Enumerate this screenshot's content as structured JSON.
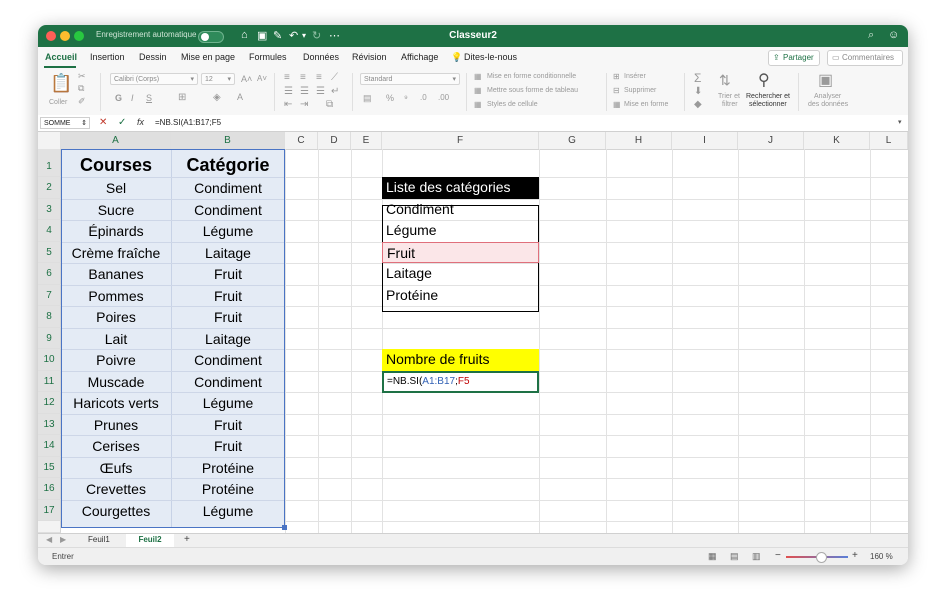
{
  "titlebar": {
    "autosave_label": "Enregistrement automatique",
    "document_title": "Classeur2"
  },
  "menu": {
    "tabs": [
      "Accueil",
      "Insertion",
      "Dessin",
      "Mise en page",
      "Formules",
      "Données",
      "Révision",
      "Affichage"
    ],
    "tell_me": "Dites-le-nous",
    "share": "Partager",
    "comments": "Commentaires"
  },
  "ribbon": {
    "paste": "Coller",
    "font_name": "Calibri (Corps)",
    "font_size": "12",
    "number_format": "Standard",
    "conditional_format": "Mise en forme conditionnelle",
    "format_as_table": "Mettre sous forme de tableau",
    "cell_styles": "Styles de cellule",
    "insert": "Insérer",
    "delete": "Supprimer",
    "format": "Mise en forme",
    "sort_filter_1": "Trier et",
    "sort_filter_2": "filtrer",
    "find_select_1": "Rechercher et",
    "find_select_2": "sélectionner",
    "analyze_1": "Analyser",
    "analyze_2": "des données"
  },
  "formula_bar": {
    "name_box": "SOMME",
    "fx": "fx",
    "content": "=NB.SI(A1:B17;F5"
  },
  "columns": [
    "A",
    "B",
    "C",
    "D",
    "E",
    "F",
    "G",
    "H",
    "I",
    "J",
    "K",
    "L"
  ],
  "rows": [
    "1",
    "2",
    "3",
    "4",
    "5",
    "6",
    "7",
    "8",
    "9",
    "10",
    "11",
    "12",
    "13",
    "14",
    "15",
    "16",
    "17"
  ],
  "table": {
    "header_a": "Courses",
    "header_b": "Catégorie",
    "items": [
      {
        "course": "Sel",
        "categorie": "Condiment"
      },
      {
        "course": "Sucre",
        "categorie": "Condiment"
      },
      {
        "course": "Épinards",
        "categorie": "Légume"
      },
      {
        "course": "Crème fraîche",
        "categorie": "Laitage"
      },
      {
        "course": "Bananes",
        "categorie": "Fruit"
      },
      {
        "course": "Pommes",
        "categorie": "Fruit"
      },
      {
        "course": "Poires",
        "categorie": "Fruit"
      },
      {
        "course": "Lait",
        "categorie": "Laitage"
      },
      {
        "course": "Poivre",
        "categorie": "Condiment"
      },
      {
        "course": "Muscade",
        "categorie": "Condiment"
      },
      {
        "course": "Haricots verts",
        "categorie": "Légume"
      },
      {
        "course": "Prunes",
        "categorie": "Fruit"
      },
      {
        "course": "Cerises",
        "categorie": "Fruit"
      },
      {
        "course": "Œufs",
        "categorie": "Protéine"
      },
      {
        "course": "Crevettes",
        "categorie": "Protéine"
      },
      {
        "course": "Courgettes",
        "categorie": "Légume"
      }
    ]
  },
  "category_list": {
    "header": "Liste des catégories",
    "items": [
      "Condiment",
      "Légume",
      "Fruit",
      "Laitage",
      "Protéine"
    ]
  },
  "fruit_count": {
    "label": "Nombre de fruits",
    "formula_prefix": "=NB.SI(",
    "formula_range": "A1:B17",
    "formula_sep": ";",
    "formula_ref": "F5"
  },
  "sheets": {
    "tab1": "Feuil1",
    "tab2": "Feuil2"
  },
  "status": {
    "mode": "Entrer",
    "zoom": "160 %"
  },
  "colors": {
    "excel_green": "#1e7145",
    "selection_fill": "#e4ebf5",
    "selection_border": "#4a74c4",
    "header_black": "#000000",
    "label_yellow": "#ffff00",
    "ref_red": "#c00000",
    "ref_blue": "#2f5fb3"
  }
}
